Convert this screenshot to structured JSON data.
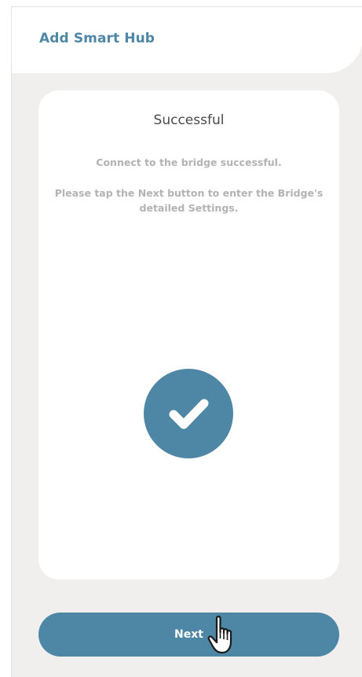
{
  "header": {
    "title": "Add Smart Hub"
  },
  "card": {
    "title": "Successful",
    "message_1": "Connect to the bridge successful.",
    "message_2": "Please tap the Next button to enter the Bridge's detailed Settings.",
    "status_icon": "checkmark-icon"
  },
  "footer": {
    "next_label": "Next"
  },
  "cursor": {
    "icon": "hand-pointer-icon"
  },
  "colors": {
    "accent": "#4d87a5",
    "background": "#f0efed",
    "card": "#ffffff",
    "muted_text": "#b3b3b3",
    "title_text": "#4a4a4a"
  }
}
